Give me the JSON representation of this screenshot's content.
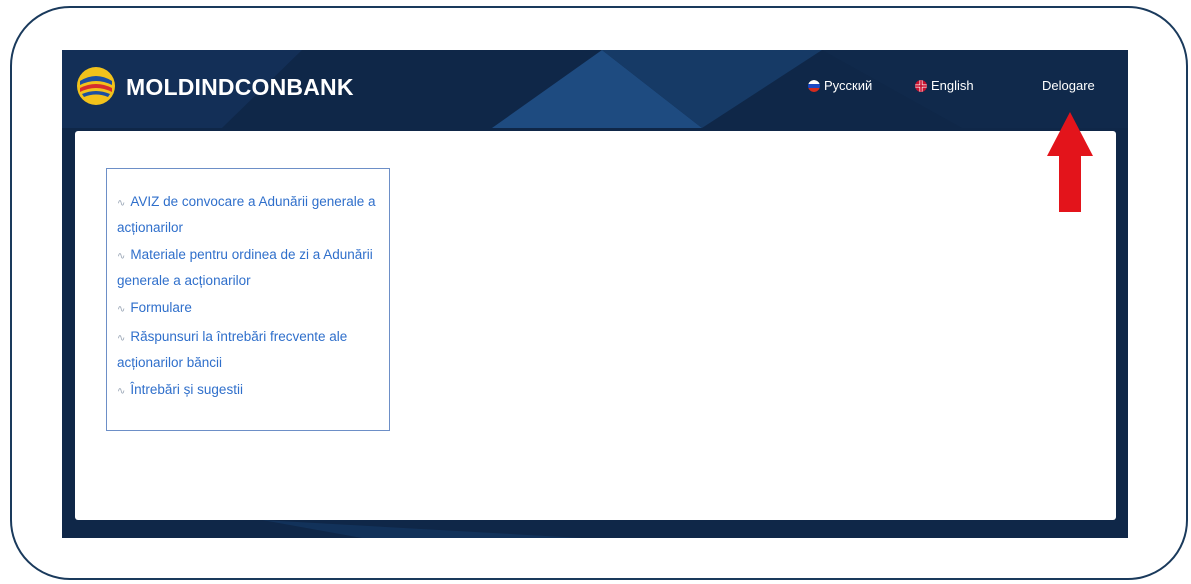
{
  "header": {
    "brand": "MOLDINDCONBANK",
    "languages": [
      {
        "label": "Русский",
        "flag_colors": [
          "#ffffff",
          "#1c49c4",
          "#d52b1e"
        ]
      },
      {
        "label": "English",
        "flag_colors": [
          "#ffffff",
          "#c8102e"
        ]
      }
    ],
    "logout_label": "Delogare"
  },
  "menu": {
    "items": [
      {
        "label": "AVIZ de convocare a Adunării generale a acționarilor"
      },
      {
        "label": "Materiale pentru ordinea de zi a Adunării generale a acționarilor"
      },
      {
        "label": "Formulare"
      },
      {
        "label": "Răspunsuri la întrebări frecvente ale acționarilor băncii"
      },
      {
        "label": "Întrebări și sugestii"
      }
    ]
  },
  "colors": {
    "header_bg": "#0f2748",
    "link": "#2f6fcb",
    "menu_border": "#6d8fc7",
    "annotation_arrow": "#e3141b"
  }
}
